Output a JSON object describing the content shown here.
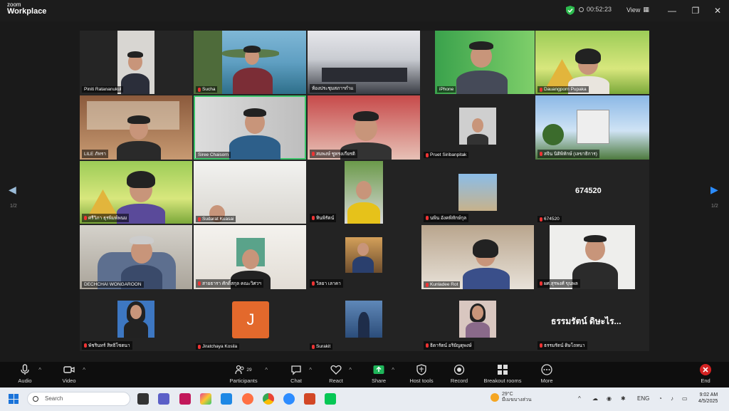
{
  "titlebar": {
    "logo_line1": "zoom",
    "logo_line2": "Workplace",
    "meeting_timer": "00:52:23",
    "view_label": "View"
  },
  "participants": [
    {
      "name": "Piniti Ratananukul",
      "muted": false
    },
    {
      "name": "Sucha",
      "muted": true
    },
    {
      "name": "ห้องประชุมสภาฯกำแ",
      "muted": false
    },
    {
      "name": "iPhone",
      "muted": false
    },
    {
      "name": "Dauangporn Pupaka",
      "muted": true
    },
    {
      "name": "LILE ภัทรา",
      "muted": false
    },
    {
      "name": "Siree Chaisorn",
      "muted": false
    },
    {
      "name": "สมพงษ์ ชูทรงเกียรติ",
      "muted": true
    },
    {
      "name": "Pruet Siribanpitak",
      "muted": true
    },
    {
      "name": "สจิน นิติพิทักษ์ (เลขาธิการ)",
      "muted": true
    },
    {
      "name": "ศรีวิภา ธุรพิมพ์พนม",
      "muted": true
    },
    {
      "name": "Sudarat Kuasai",
      "muted": true
    },
    {
      "name": "ทินพิรัตน์",
      "muted": true
    },
    {
      "name": "นพิน อังคพิทักษ์กุล",
      "muted": true
    },
    {
      "name": "674520",
      "muted": true
    },
    {
      "name": "DECHCHAI WONGAROON",
      "muted": false
    },
    {
      "name": "สายธารา ศักดิ์สกุล คณะวิศวฯ",
      "muted": true
    },
    {
      "name": "วิลยา เลาคา",
      "muted": true
    },
    {
      "name": "Kunladee Rot",
      "muted": true
    },
    {
      "name": "ผศ.สุรพงศ์ ขุนพล",
      "muted": true
    },
    {
      "name": "พัชรินทร์ สิทธิโชตนา",
      "muted": true
    },
    {
      "name": "Jiratchaya Kosila",
      "muted": true
    },
    {
      "name": "Surakit",
      "muted": true
    },
    {
      "name": "ธิดารัตน์ อริยัญดุพงษ์",
      "muted": true
    },
    {
      "name": "ธรรมรัตน์ ดิษโถหนา",
      "muted": true
    }
  ],
  "video_off_ids": {
    "id_674520": "674520",
    "id_last": "ธรรมรัตน์ ดิษะไร..."
  },
  "avatar_initial": "J",
  "pager": {
    "left_arrow": "◀",
    "right_arrow": "▶",
    "left_page": "1/2",
    "right_page": "1/2"
  },
  "toolbar": {
    "audio": "Audio",
    "video": "Video",
    "participants": "Participants",
    "participants_count": "29",
    "chat": "Chat",
    "react": "React",
    "share": "Share",
    "host_tools": "Host tools",
    "record": "Record",
    "breakout_rooms": "Breakout rooms",
    "more": "More",
    "end": "End"
  },
  "taskbar": {
    "search_placeholder": "Search",
    "temperature": "29°C",
    "weather_desc": "มีเมฆบางส่วน",
    "lang": "ENG",
    "time": "9:02 AM",
    "date": "4/5/2025"
  },
  "colors": {
    "active_speaker": "#3cc46a",
    "share_green": "#1fb65a",
    "end_red": "#d22222",
    "avatar_orange": "#e3692c"
  }
}
